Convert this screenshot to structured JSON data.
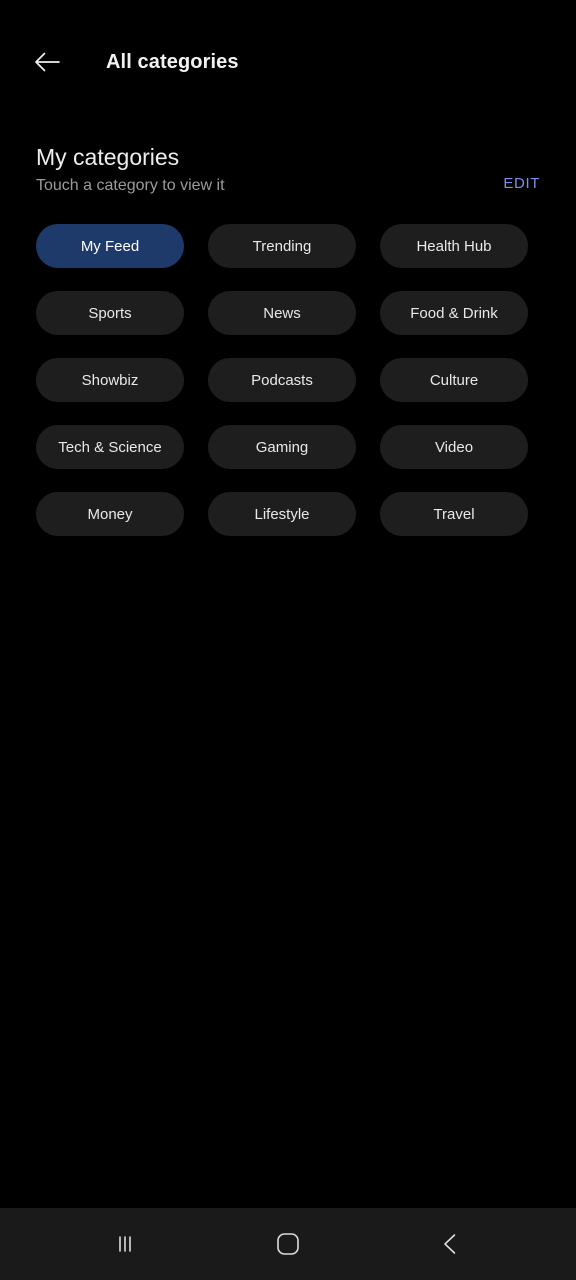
{
  "appbar": {
    "back_icon": "arrow-left-icon",
    "title": "All categories"
  },
  "section": {
    "title": "My categories",
    "subtitle": "Touch a category to view it",
    "edit_label": "EDIT"
  },
  "colors": {
    "page_background": "#000000",
    "chip_background": "#1e1e1e",
    "chip_selected_background": "#1d3a6b",
    "edit_link": "#7b90e8",
    "navbar_background": "#1a1a1a",
    "primary_text": "#ededed",
    "secondary_text": "#9b9b9b"
  },
  "categories": [
    {
      "label": "My Feed",
      "selected": true
    },
    {
      "label": "Trending",
      "selected": false
    },
    {
      "label": "Health Hub",
      "selected": false
    },
    {
      "label": "Sports",
      "selected": false
    },
    {
      "label": "News",
      "selected": false
    },
    {
      "label": "Food & Drink",
      "selected": false
    },
    {
      "label": "Showbiz",
      "selected": false
    },
    {
      "label": "Podcasts",
      "selected": false
    },
    {
      "label": "Culture",
      "selected": false
    },
    {
      "label": "Tech & Science",
      "selected": false
    },
    {
      "label": "Gaming",
      "selected": false
    },
    {
      "label": "Video",
      "selected": false
    },
    {
      "label": "Money",
      "selected": false
    },
    {
      "label": "Lifestyle",
      "selected": false
    },
    {
      "label": "Travel",
      "selected": false
    }
  ],
  "navbar": {
    "recents_icon": "recents-icon",
    "home_icon": "home-icon",
    "back_icon": "chevron-left-icon"
  }
}
